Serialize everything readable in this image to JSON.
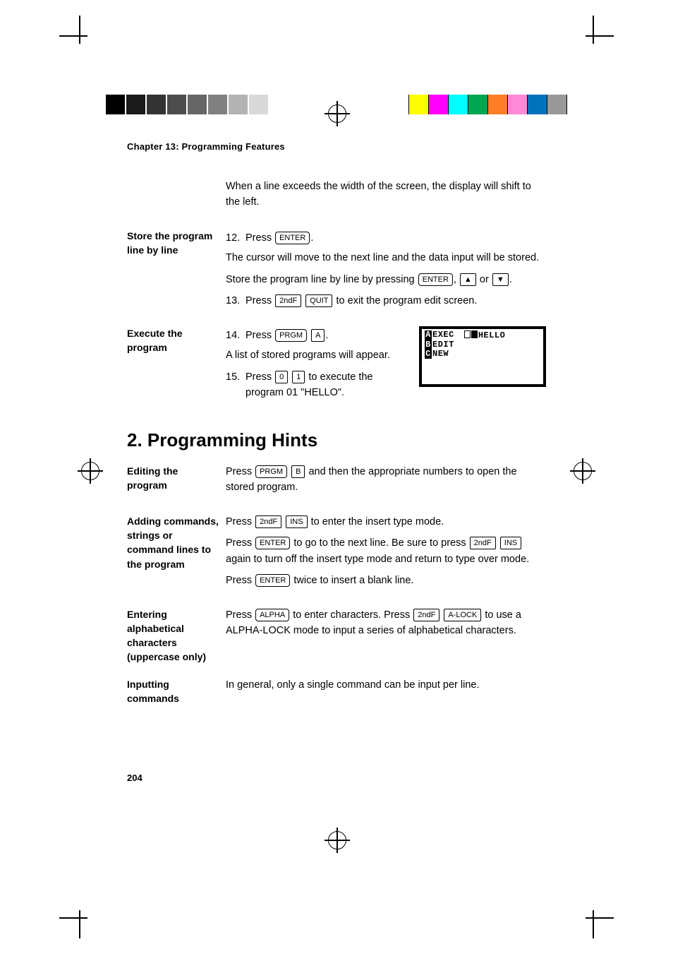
{
  "chapter_title": "Chapter 13: Programming Features",
  "page_number": "204",
  "intro_para": "When a line exceeds the width of the screen, the display will shift to the left.",
  "store": {
    "side": "Store the program line by line",
    "step12_num": "12.",
    "step12_a": "Press ",
    "step12_b": ".",
    "p1": "The cursor will move to the next line and the data input will be stored.",
    "p2a": "Store the program line by line by pressing ",
    "p2b": ", ",
    "p2c": " or ",
    "p2d": ".",
    "step13_num": "13.",
    "step13_a": "Press ",
    "step13_b": " to exit the program edit screen."
  },
  "exec": {
    "side": "Execute the program",
    "step14_num": "14.",
    "step14_a": "Press ",
    "step14_b": ".",
    "p1": "A list of stored programs will appear.",
    "step15_num": "15.",
    "step15_a": "Press ",
    "step15_b": " to execute the program 01 \"HELLO\"."
  },
  "calc": {
    "a_label": "A",
    "a_text": "EXEC",
    "b_label": "B",
    "b_text": "EDIT",
    "c_label": "C",
    "c_text": "NEW",
    "slot_num": "01",
    "slot_name": "HELLO"
  },
  "section_heading": "2. Programming Hints",
  "edit": {
    "side": "Editing the program",
    "a": "Press ",
    "b": " and then the appropriate numbers to open the stored program."
  },
  "add": {
    "side": "Adding commands, strings or command lines to the program",
    "p1a": "Press ",
    "p1b": " to enter the insert type mode.",
    "p2a": "Press ",
    "p2b": " to go to the next line. Be sure to press ",
    "p2c": " again to turn off the insert type mode and return to type over mode.",
    "p3a": "Press ",
    "p3b": " twice to insert a blank line."
  },
  "alpha": {
    "side": "Entering alphabetical characters (uppercase only)",
    "a": "Press ",
    "b": " to enter characters. Press ",
    "c": " to use a ALPHA-LOCK mode to input a series of alphabetical characters."
  },
  "input": {
    "side": "Inputting commands",
    "text": "In general, only a single command can be input per line."
  },
  "keys": {
    "enter": "ENTER",
    "up": "▲",
    "down": "▼",
    "secondf": "2ndF",
    "quit": "QUIT",
    "prgm": "PRGM",
    "A": "A",
    "zero": "0",
    "one": "1",
    "B": "B",
    "ins": "INS",
    "alpha": "ALPHA",
    "alock": "A-LOCK"
  },
  "gray_swatches": [
    "#000000",
    "#1a1a1a",
    "#333333",
    "#4d4d4d",
    "#666666",
    "#808080",
    "#b3b3b3",
    "#d9d9d9",
    "#ffffff"
  ],
  "color_swatches": [
    "#ffff00",
    "#ff00ff",
    "#00ffff",
    "#00a651",
    "#ff7f27",
    "#ff8ad8",
    "#0072bc",
    "#999999"
  ]
}
